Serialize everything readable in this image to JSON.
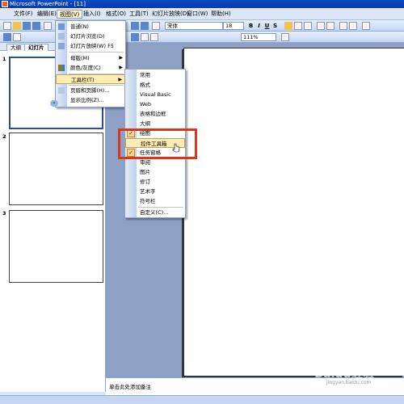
{
  "window": {
    "title": "Microsoft PowerPoint - [11]"
  },
  "menubar": {
    "items": [
      {
        "label": "文件(F)"
      },
      {
        "label": "编辑(E)"
      },
      {
        "label": "视图(V)"
      },
      {
        "label": "插入(I)"
      },
      {
        "label": "格式(O)"
      },
      {
        "label": "工具(T)"
      },
      {
        "label": "幻灯片放映(D)"
      },
      {
        "label": "窗口(W)"
      },
      {
        "label": "帮助(H)"
      }
    ]
  },
  "toolbar": {
    "font": "宋体",
    "font_size": "18",
    "zoom": "111%",
    "bold": "B",
    "italic": "I",
    "underline": "U",
    "shadow": "S"
  },
  "left_pane": {
    "tabs": [
      "大纲",
      "幻灯片"
    ],
    "slides": [
      "1",
      "2",
      "3"
    ]
  },
  "view_menu": {
    "items": [
      {
        "label": "普通(N)",
        "icon": "normal-view-icon"
      },
      {
        "label": "幻灯片浏览(D)",
        "icon": "slide-sorter-icon"
      },
      {
        "label": "幻灯片放映(W)",
        "shortcut": "F5",
        "icon": "slideshow-icon"
      },
      {
        "label": "母版(M)",
        "icon": ""
      },
      {
        "label": "颜色/灰度(C)",
        "icon": "color-grayscale-icon"
      },
      {
        "label": "工具栏(T)",
        "icon": ""
      },
      {
        "label": "页眉和页脚(H)...",
        "icon": "header-footer-icon"
      },
      {
        "label": "显示比例(Z)...",
        "icon": ""
      }
    ],
    "expand": "»"
  },
  "toolbars_submenu": {
    "items": [
      {
        "label": "常用",
        "checked": false
      },
      {
        "label": "格式",
        "checked": false
      },
      {
        "label": "Visual Basic",
        "checked": false
      },
      {
        "label": "Web",
        "checked": false
      },
      {
        "label": "表格和边框",
        "checked": false
      },
      {
        "label": "大纲",
        "checked": false
      },
      {
        "label": "绘图",
        "checked": true
      },
      {
        "label": "控件工具箱",
        "checked": false
      },
      {
        "label": "任务窗格",
        "checked": true
      },
      {
        "label": "审阅",
        "checked": false
      },
      {
        "label": "图片",
        "checked": false
      },
      {
        "label": "修订",
        "checked": false
      },
      {
        "label": "艺术字",
        "checked": false
      },
      {
        "label": "符号栏",
        "checked": false
      },
      {
        "label": "自定义(C)...",
        "checked": false
      }
    ]
  },
  "notes": {
    "placeholder": "单击此处添加备注"
  },
  "watermark": {
    "text": "Baidu经验",
    "sub": "jingyan.baidu.com"
  },
  "colors": {
    "highlight": "#FFEDB5",
    "annotation": "#D9361C",
    "title_bar": "#0A4CC4"
  }
}
